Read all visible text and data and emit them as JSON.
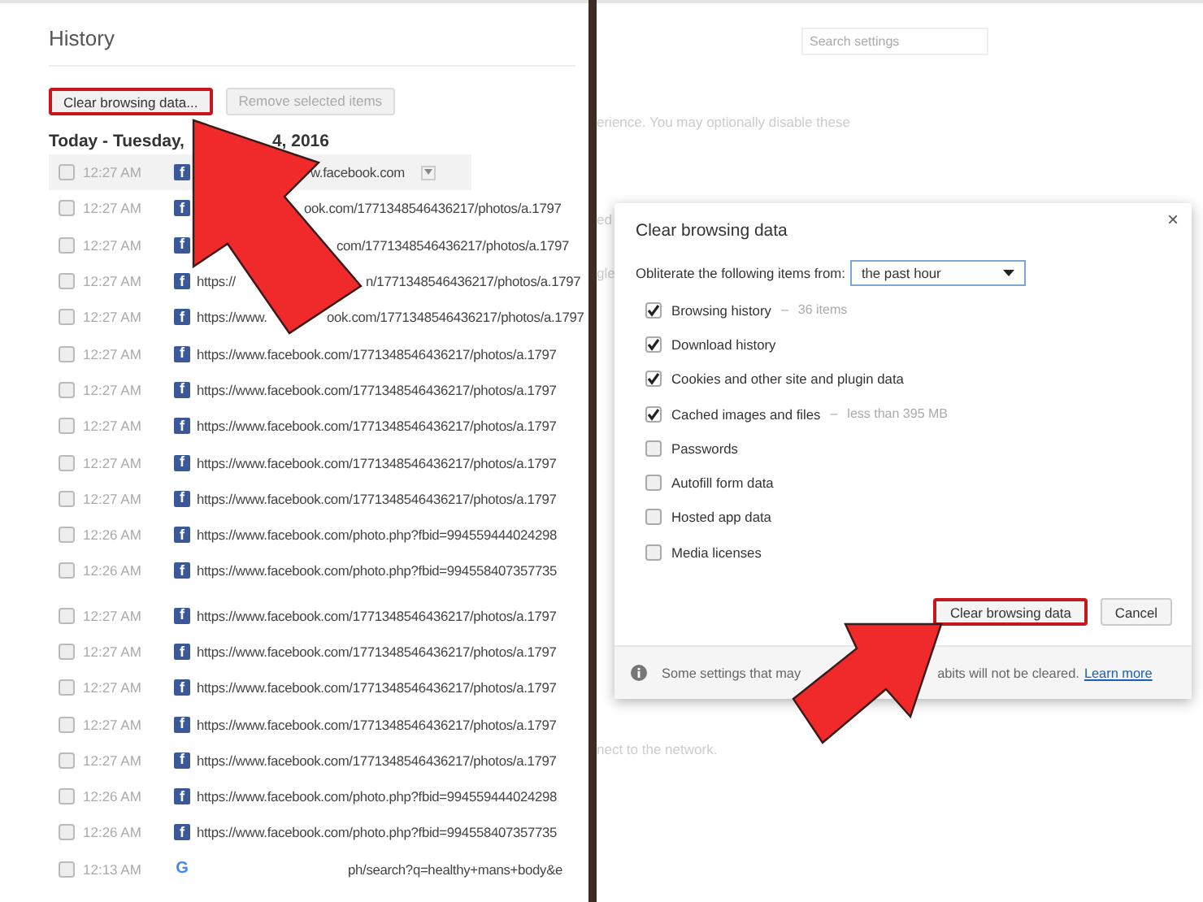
{
  "history": {
    "title": "History",
    "buttons": [
      {
        "label": "Clear browsing data...",
        "highlighted": true,
        "disabled": false
      },
      {
        "label": "Remove selected items",
        "highlighted": false,
        "disabled": true
      }
    ],
    "date_heading": {
      "start": "Today - Tuesday,",
      "end": "4, 2016"
    },
    "rows": [
      {
        "time": "12:27 AM",
        "checked": false,
        "highlighted": true,
        "favicon": {
          "kind": "square",
          "glyph": "f"
        },
        "url_start": "",
        "url_end": "w.facebook.com",
        "menu_button": true
      },
      {
        "time": "12:27 AM",
        "checked": false,
        "highlighted": false,
        "favicon": {
          "kind": "square",
          "glyph": "f"
        },
        "url_start": "",
        "url_end": "ook.com/1771348546436217/photos/a.1797",
        "menu_button": false
      },
      {
        "time": "12:27 AM",
        "checked": false,
        "highlighted": false,
        "favicon": {
          "kind": "square",
          "glyph": "f"
        },
        "url_start": "",
        "url_end": "com/1771348546436217/photos/a.1797",
        "menu_button": false
      },
      {
        "time": "12:27 AM",
        "checked": false,
        "highlighted": false,
        "favicon": {
          "kind": "square",
          "glyph": "f"
        },
        "url_start": "https://",
        "url_end": "n/1771348546436217/photos/a.1797"
      },
      {
        "time": "12:27 AM",
        "checked": false,
        "highlighted": false,
        "favicon": {
          "kind": "square",
          "glyph": "f"
        },
        "url_start": "https://www.",
        "url_end": "ook.com/1771348546436217/photos/a.1797"
      },
      {
        "time": "12:27 AM",
        "checked": false,
        "highlighted": false,
        "favicon": {
          "kind": "square",
          "glyph": "f"
        },
        "url_start": "",
        "url_end": "https://www.facebook.com/1771348546436217/photos/a.1797",
        "menu_button": false
      },
      {
        "time": "12:27 AM",
        "checked": false,
        "highlighted": false,
        "favicon": {
          "kind": "square",
          "glyph": "f"
        },
        "url_start": "",
        "url_end": "https://www.facebook.com/1771348546436217/photos/a.1797",
        "menu_button": false
      },
      {
        "time": "12:27 AM",
        "checked": false,
        "highlighted": false,
        "favicon": {
          "kind": "square",
          "glyph": "f"
        },
        "url_start": "",
        "url_end": "https://www.facebook.com/1771348546436217/photos/a.1797",
        "menu_button": false
      },
      {
        "time": "12:27 AM",
        "checked": false,
        "highlighted": false,
        "favicon": {
          "kind": "square",
          "glyph": "f"
        },
        "url_start": "",
        "url_end": "https://www.facebook.com/1771348546436217/photos/a.1797",
        "menu_button": false
      },
      {
        "time": "12:27 AM",
        "checked": false,
        "highlighted": false,
        "favicon": {
          "kind": "square",
          "glyph": "f"
        },
        "url_start": "",
        "url_end": "https://www.facebook.com/1771348546436217/photos/a.1797",
        "menu_button": false
      },
      {
        "time": "12:26 AM",
        "checked": false,
        "highlighted": false,
        "favicon": {
          "kind": "square",
          "glyph": "f"
        },
        "url_start": "",
        "url_end": "https://www.facebook.com/photo.php?fbid=994559444024298",
        "menu_button": false
      },
      {
        "time": "12:26 AM",
        "checked": false,
        "highlighted": false,
        "favicon": {
          "kind": "square",
          "glyph": "f"
        },
        "url_start": "",
        "url_end": "https://www.facebook.com/photo.php?fbid=994558407357735",
        "menu_button": false
      },
      {
        "time": "12:27 AM",
        "checked": false,
        "highlighted": false,
        "favicon": {
          "kind": "square",
          "glyph": "f"
        },
        "url_start": "",
        "url_end": "https://www.facebook.com/1771348546436217/photos/a.1797",
        "menu_button": false
      },
      {
        "time": "12:27 AM",
        "checked": false,
        "highlighted": false,
        "favicon": {
          "kind": "square",
          "glyph": "f"
        },
        "url_start": "",
        "url_end": "https://www.facebook.com/1771348546436217/photos/a.1797",
        "menu_button": false
      },
      {
        "time": "12:27 AM",
        "checked": false,
        "highlighted": false,
        "favicon": {
          "kind": "square",
          "glyph": "f"
        },
        "url_start": "",
        "url_end": "https://www.facebook.com/1771348546436217/photos/a.1797",
        "menu_button": false
      },
      {
        "time": "12:27 AM",
        "checked": false,
        "highlighted": false,
        "favicon": {
          "kind": "square",
          "glyph": "f"
        },
        "url_start": "",
        "url_end": "https://www.facebook.com/1771348546436217/photos/a.1797",
        "menu_button": false
      },
      {
        "time": "12:27 AM",
        "checked": false,
        "highlighted": false,
        "favicon": {
          "kind": "square",
          "glyph": "f"
        },
        "url_start": "",
        "url_end": "https://www.facebook.com/1771348546436217/photos/a.1797",
        "menu_button": false
      },
      {
        "time": "12:26 AM",
        "checked": false,
        "highlighted": false,
        "favicon": {
          "kind": "square",
          "glyph": "f"
        },
        "url_start": "",
        "url_end": "https://www.facebook.com/photo.php?fbid=994559444024298",
        "menu_button": false
      },
      {
        "time": "12:26 AM",
        "checked": false,
        "highlighted": false,
        "favicon": {
          "kind": "square",
          "glyph": "f"
        },
        "url_start": "",
        "url_end": "https://www.facebook.com/photo.php?fbid=994558407357735",
        "menu_button": false
      },
      {
        "time": "12:13 AM",
        "checked": false,
        "highlighted": false,
        "favicon": {
          "kind": "round",
          "glyph": "G"
        },
        "url_start": "",
        "url_end": "ph/search?q=healthy+mans+body&e",
        "menu_button": false
      }
    ]
  },
  "settings": {
    "search": {
      "placeholder": "Search settings"
    },
    "fragments": [
      "erience. You may optionally disable these",
      "ed",
      "gle",
      "nect to the network."
    ]
  },
  "dialog": {
    "title": "Clear browsing data",
    "close": "×",
    "range_label": "Obliterate the following items from:",
    "range_value": "the past hour",
    "items": [
      {
        "label": "Browsing history",
        "separator": "–",
        "detail": "36 items",
        "checked": true
      },
      {
        "label": "Download history",
        "checked": true
      },
      {
        "label": "Cookies and other site and plugin data",
        "checked": true
      },
      {
        "label": "Cached images and files",
        "separator": "–",
        "detail": "less than 395 MB",
        "checked": true
      },
      {
        "label": "Passwords",
        "checked": false
      },
      {
        "label": "Autofill form data",
        "checked": false
      },
      {
        "label": "Hosted app data",
        "checked": false
      },
      {
        "label": "Media licenses",
        "checked": false
      }
    ],
    "buttons": [
      {
        "label": "Clear browsing data",
        "highlighted": true
      },
      {
        "label": "Cancel",
        "highlighted": false
      }
    ],
    "footer": {
      "start": "Some settings that may",
      "end": "abits will not be cleared.",
      "link": "Learn more"
    }
  }
}
